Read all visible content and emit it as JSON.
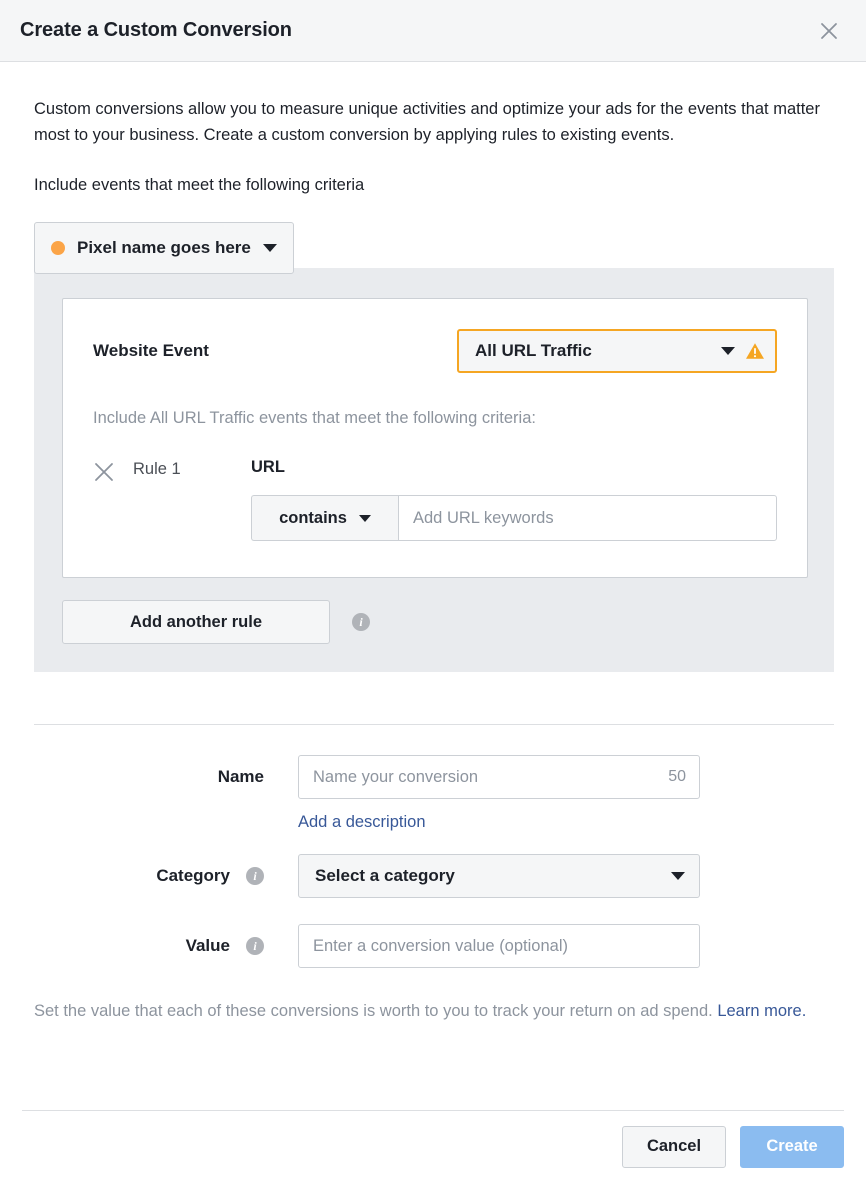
{
  "dialog": {
    "title": "Create a Custom Conversion",
    "close_icon": "close-icon"
  },
  "intro": {
    "paragraph": "Custom conversions allow you to measure unique activities and optimize your ads for the events that matter most to your business. Create a custom conversion by applying rules to existing events.",
    "criteria_heading": "Include events that meet the following criteria"
  },
  "pixel_selector": {
    "name": "Pixel name goes here",
    "dot_color": "#fba447",
    "caret_icon": "chevron-down-icon"
  },
  "rules_panel": {
    "event": {
      "label": "Website Event",
      "selected": "All URL Traffic",
      "warning_icon": "warning-triangle-icon",
      "warning_color": "#f5a623",
      "border_color": "#f5a623"
    },
    "criteria_sub": "Include All URL Traffic events that meet the following criteria:",
    "rules": [
      {
        "remove_icon": "close-icon",
        "name": "Rule 1",
        "field_title": "URL",
        "operator": "contains",
        "value": "",
        "value_placeholder": "Add URL keywords"
      }
    ],
    "add_rule_label": "Add another rule",
    "add_rule_info_icon": "info-icon"
  },
  "form": {
    "name": {
      "label": "Name",
      "value": "",
      "placeholder": "Name your conversion",
      "char_counter": "50"
    },
    "add_description_link": "Add a description",
    "category": {
      "label": "Category",
      "info_icon": "info-icon",
      "selected": "Select a category",
      "caret_icon": "chevron-down-icon"
    },
    "value": {
      "label": "Value",
      "info_icon": "info-icon",
      "value": "",
      "placeholder": "Enter a conversion value (optional)"
    },
    "helper_text": "Set the value that each of these conversions is worth to you to track your return on ad spend. ",
    "helper_link": "Learn more."
  },
  "footer": {
    "cancel_label": "Cancel",
    "create_label": "Create",
    "create_color": "#8bbcf0"
  }
}
